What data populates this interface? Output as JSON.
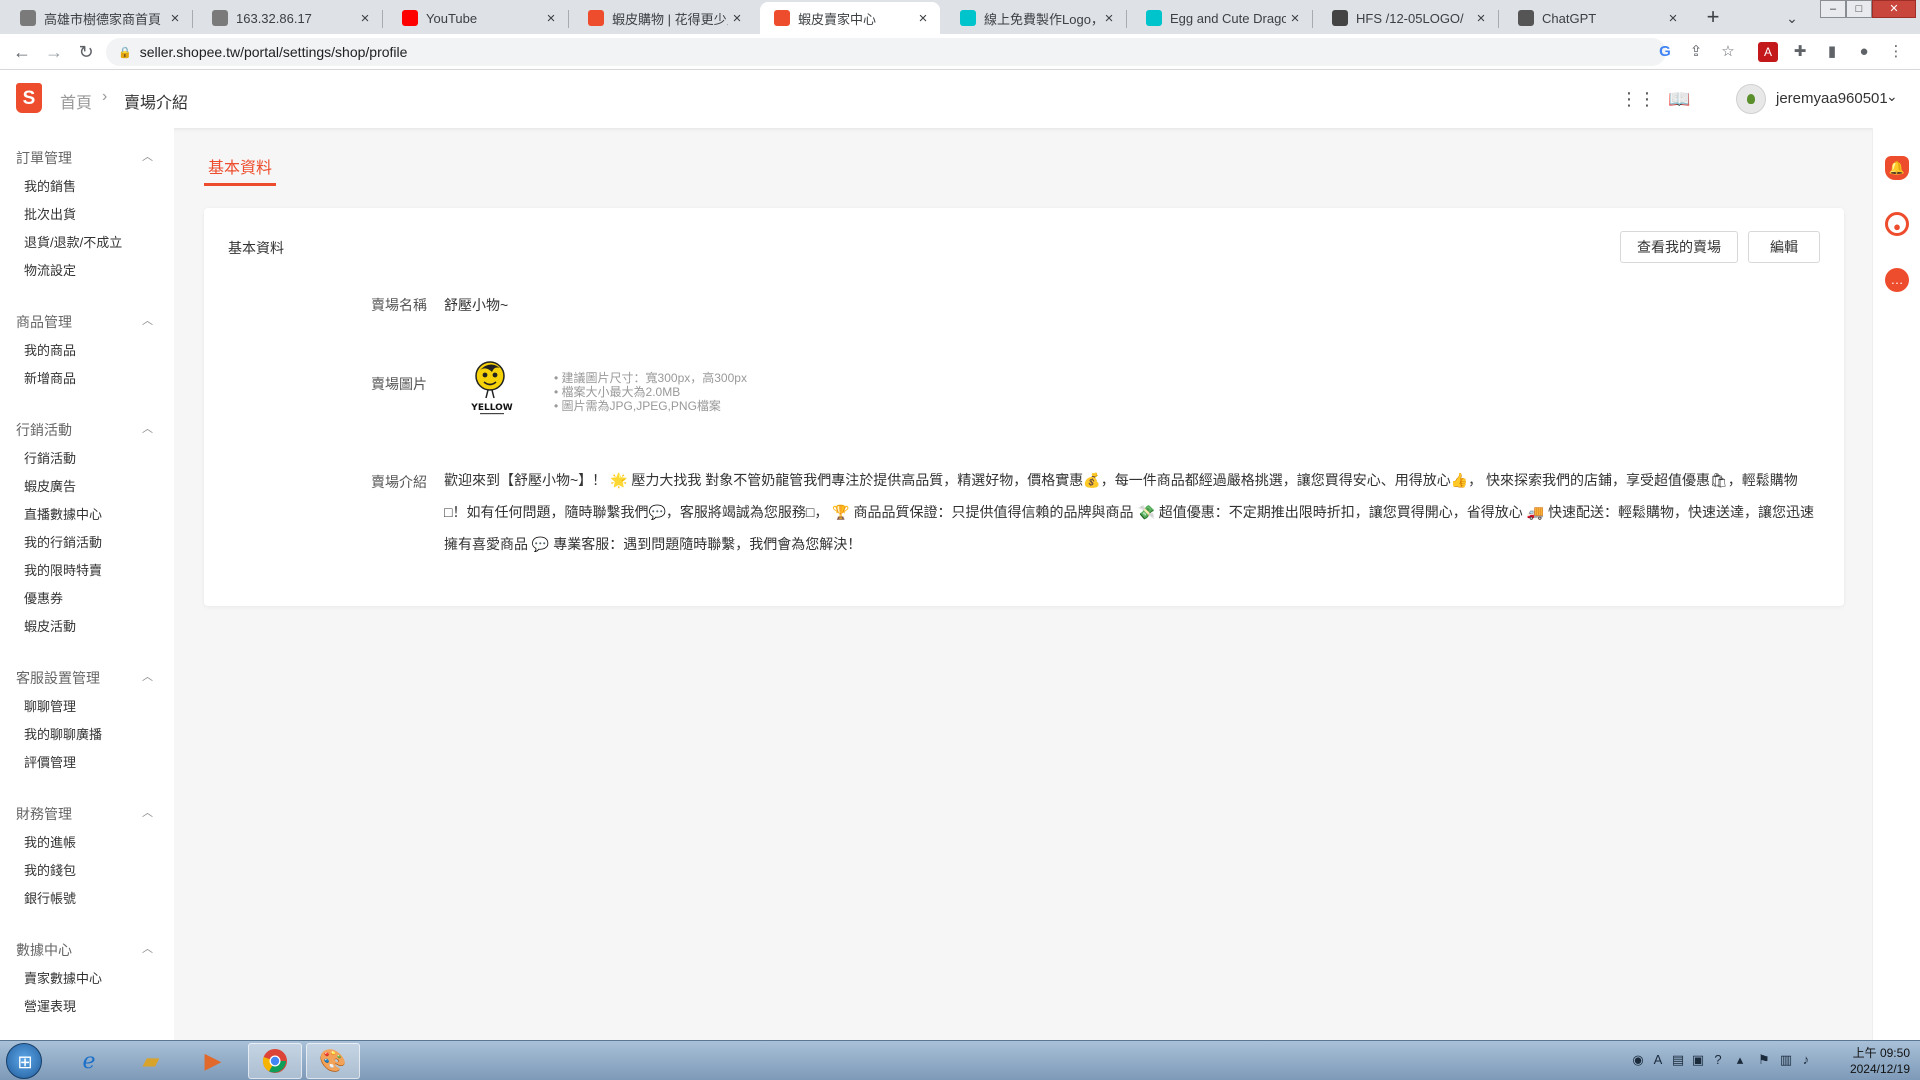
{
  "browser": {
    "tabs": [
      {
        "title": "高雄市樹德家商首頁",
        "favicon": "globe-icon",
        "color": "#7a7a7a"
      },
      {
        "title": "163.32.86.17",
        "favicon": "globe-icon",
        "color": "#7a7a7a"
      },
      {
        "title": "YouTube",
        "favicon": "youtube-icon",
        "color": "#ff0000"
      },
      {
        "title": "蝦皮購物 | 花得更少買得",
        "favicon": "shopee-icon",
        "color": "#ee4d2d"
      },
      {
        "title": "蝦皮賣家中心",
        "favicon": "shopee-icon",
        "color": "#ee4d2d"
      },
      {
        "title": "線上免費製作Logo，並",
        "favicon": "canva-icon",
        "color": "#00c4cc"
      },
      {
        "title": "Egg and Cute Dragon",
        "favicon": "canva-icon",
        "color": "#00c4cc"
      },
      {
        "title": "HFS /12-05LOGO/",
        "favicon": "hfs-icon",
        "color": "#444444"
      },
      {
        "title": "ChatGPT",
        "favicon": "chatgpt-icon",
        "color": "#555555"
      }
    ],
    "url": "seller.shopee.tw/portal/settings/shop/profile"
  },
  "header": {
    "breadcrumb_home": "首頁",
    "breadcrumb_current": "賣場介紹",
    "username": "jeremyaa960501"
  },
  "sidebar": {
    "groups": [
      {
        "title": "訂單管理",
        "items": [
          "我的銷售",
          "批次出貨",
          "退貨/退款/不成立",
          "物流設定"
        ]
      },
      {
        "title": "商品管理",
        "items": [
          "我的商品",
          "新增商品"
        ]
      },
      {
        "title": "行銷活動",
        "items": [
          "行銷活動",
          "蝦皮廣告",
          "直播數據中心",
          "我的行銷活動",
          "我的限時特賣",
          "優惠券",
          "蝦皮活動"
        ]
      },
      {
        "title": "客服設置管理",
        "items": [
          "聊聊管理",
          "我的聊聊廣播",
          "評價管理"
        ]
      },
      {
        "title": "財務管理",
        "items": [
          "我的進帳",
          "我的錢包",
          "銀行帳號"
        ]
      },
      {
        "title": "數據中心",
        "items": [
          "賣家數據中心",
          "營運表現"
        ]
      }
    ]
  },
  "main": {
    "active_tab": "基本資料",
    "card_title": "基本資料",
    "view_shop_button": "查看我的賣場",
    "edit_button": "編輯",
    "shop_name_label": "賣場名稱",
    "shop_name_value": "舒壓小物~",
    "shop_image_label": "賣場圖片",
    "logo_text": "YELLOW",
    "image_tips": [
      "建議圖片尺寸：寬300px，高300px",
      "檔案大小最大為2.0MB",
      "圖片需為JPG,JPEG,PNG檔案"
    ],
    "intro_label": "賣場介紹",
    "intro_text": "歡迎來到【舒壓小物~】！ 🌟 壓力大找我 對象不管奶龍管我們專注於提供高品質，精選好物，價格實惠💰，每一件商品都經過嚴格挑選，讓您買得安心、用得放心👍， 快來探索我們的店鋪，享受超值優惠🛍，輕鬆購物□！如有任何問題，隨時聯繫我們💬，客服將竭誠為您服務□， 🏆 商品品質保證：只提供值得信賴的品牌與商品 💸 超值優惠：不定期推出限時折扣，讓您買得開心，省得放心 🚚 快速配送：輕鬆購物，快速送達，讓您迅速擁有喜愛商品 💬 專業客服：遇到問題隨時聯繫，我們會為您解決！"
  },
  "taskbar": {
    "clock_time": "上午 09:50",
    "clock_date": "2024/12/19"
  },
  "colors": {
    "brand": "#ee4d2d",
    "page_bg": "#f6f6f6"
  }
}
